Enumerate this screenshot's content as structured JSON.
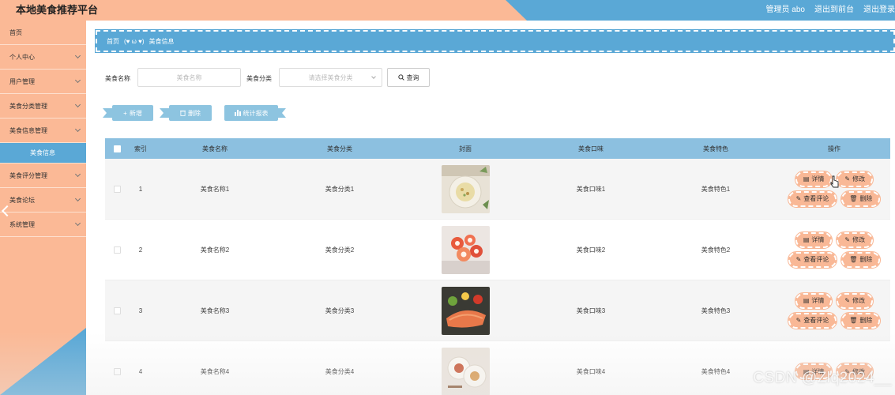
{
  "header": {
    "title": "本地美食推荐平台",
    "admin": "管理员 abo",
    "back_front": "退出到前台",
    "logout": "退出登录"
  },
  "sidebar": {
    "items": [
      {
        "label": "首页"
      },
      {
        "label": "个人中心"
      },
      {
        "label": "用户管理"
      },
      {
        "label": "美食分类管理"
      },
      {
        "label": "美食信息管理"
      },
      {
        "label": "美食信息"
      },
      {
        "label": "美食评分管理"
      },
      {
        "label": "美食论坛"
      },
      {
        "label": "系统管理"
      }
    ]
  },
  "breadcrumb": {
    "home": "首页",
    "emoticon": "(♥ ω ♥)",
    "current": "美食信息"
  },
  "search": {
    "name_label": "美食名称",
    "name_placeholder": "美食名称",
    "cat_label": "美食分类",
    "cat_placeholder": "请选择美食分类",
    "query_label": "查询"
  },
  "actions": {
    "add": "新增",
    "delete": "删除",
    "report": "统计报表"
  },
  "table": {
    "headers": {
      "index": "索引",
      "name": "美食名称",
      "category": "美食分类",
      "cover": "封面",
      "taste": "美食口味",
      "feature": "美食特色",
      "ops": "操作"
    },
    "ops": {
      "detail": "详情",
      "edit": "修改",
      "comments": "查看评论",
      "delete": "删除"
    },
    "rows": [
      {
        "index": "1",
        "name": "美食名称1",
        "category": "美食分类1",
        "taste": "美食口味1",
        "feature": "美食特色1"
      },
      {
        "index": "2",
        "name": "美食名称2",
        "category": "美食分类2",
        "taste": "美食口味2",
        "feature": "美食特色2"
      },
      {
        "index": "3",
        "name": "美食名称3",
        "category": "美食分类3",
        "taste": "美食口味3",
        "feature": "美食特色3"
      },
      {
        "index": "4",
        "name": "美食名称4",
        "category": "美食分类4",
        "taste": "美食口味4",
        "feature": "美食特色4"
      }
    ]
  },
  "watermark": "CSDN @Zlq2024__",
  "colors": {
    "peach": "#fbb996",
    "blue": "#5aa8d6",
    "table_header": "#8cc0e0",
    "op_button": "#f9b896"
  }
}
